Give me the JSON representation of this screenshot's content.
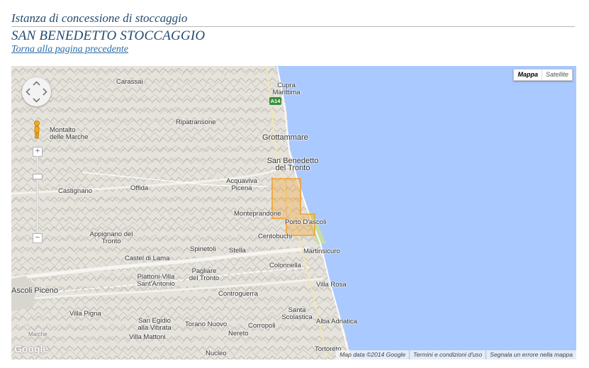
{
  "page": {
    "subtitle": "Istanza di concessione di stoccaggio",
    "title": "SAN BENEDETTO STOCCAGGIO",
    "back_link": "Torna alla pagina precedente"
  },
  "map": {
    "type_controls": {
      "map": "Mappa",
      "satellite": "Satellite"
    },
    "highway_shield": "A14",
    "logo": "Google",
    "footer": {
      "data": "Map data ©2014 Google",
      "terms": "Termini e condizioni d'uso",
      "report": "Segnala un errore nella mappa"
    },
    "places": [
      "Carassai",
      "Cupra Marittima",
      "Montalto delle Marche",
      "Ripatransone",
      "Grottammare",
      "San Benedetto del Tronto",
      "Acquaviva Picena",
      "Castignano",
      "Offida",
      "Monteprandone",
      "Porto D'ascoli",
      "Appignano del Tronto",
      "Centobuchi",
      "Spinetoli",
      "Stella",
      "Martinsicuro",
      "Castel di Lama",
      "Colonnella",
      "Piattoni-Villa Sant'Antonio",
      "Pagliare del Tronto",
      "Villa Rosa",
      "Ascoli Piceno",
      "Controguerra",
      "Villa Pigna",
      "Santa Scolastica",
      "San Egidio alla Vibrata",
      "Alba Adriatica",
      "Villa Mattoni",
      "Torano Nuovo",
      "Corropoli",
      "Nereto",
      "Tortoreto",
      "Nucleo",
      "Marche"
    ],
    "colors": {
      "sea": "#a9c9ff",
      "land": "#e6e3dc",
      "concession": "#f0a030",
      "coast_strip": "#c6dca4"
    }
  }
}
